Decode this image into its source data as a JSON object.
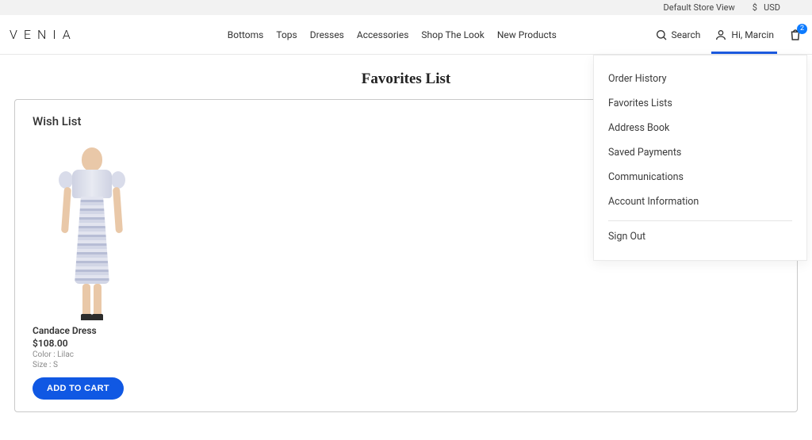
{
  "topbar": {
    "store_view": "Default Store View",
    "currency_symbol": "$",
    "currency_code": "USD"
  },
  "logo": "VENIA",
  "nav": [
    "Bottoms",
    "Tops",
    "Dresses",
    "Accessories",
    "Shop The Look",
    "New Products"
  ],
  "header": {
    "search_label": "Search",
    "greeting": "Hi, Marcin",
    "cart_count": "2"
  },
  "page_title": "Favorites List",
  "card_title": "Wish List",
  "product": {
    "name": "Candace Dress",
    "price": "$108.00",
    "attr_color": "Color : Lilac",
    "attr_size": "Size : S",
    "add_label": "ADD TO CART"
  },
  "menu": {
    "items": [
      "Order History",
      "Favorites Lists",
      "Address Book",
      "Saved Payments",
      "Communications",
      "Account Information"
    ],
    "signout": "Sign Out"
  }
}
